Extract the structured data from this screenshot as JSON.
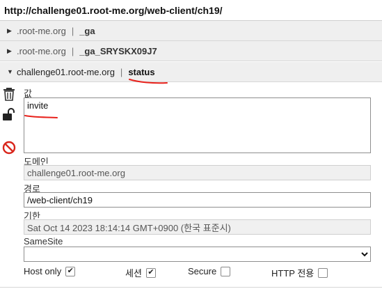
{
  "url": "http://challenge01.root-me.org/web-client/ch19/",
  "cookies": [
    {
      "domain": ".root-me.org",
      "name": "_ga",
      "expanded": false
    },
    {
      "domain": ".root-me.org",
      "name": "_ga_SRYSKX09J7",
      "expanded": false
    },
    {
      "domain": "challenge01.root-me.org",
      "name": "status",
      "expanded": true
    }
  ],
  "separator": "|",
  "editor": {
    "value_label": "값",
    "value": "invite",
    "domain_label": "도메인",
    "domain": "challenge01.root-me.org",
    "path_label": "경로",
    "path": "/web-client/ch19",
    "expires_label": "기한",
    "expires": "Sat Oct 14 2023 18:14:14 GMT+0900 (한국 표준시)",
    "samesite_label": "SameSite",
    "samesite_value": "",
    "host_only_label": "Host only",
    "host_only": true,
    "session_label": "세션",
    "session": true,
    "secure_label": "Secure",
    "secure": false,
    "http_only_label": "HTTP 전용",
    "http_only": false
  },
  "icons": [
    "trash-icon",
    "unlock-icon",
    "block-icon"
  ],
  "colors": {
    "annotation": "#e8211b",
    "block": "#d9261c"
  }
}
